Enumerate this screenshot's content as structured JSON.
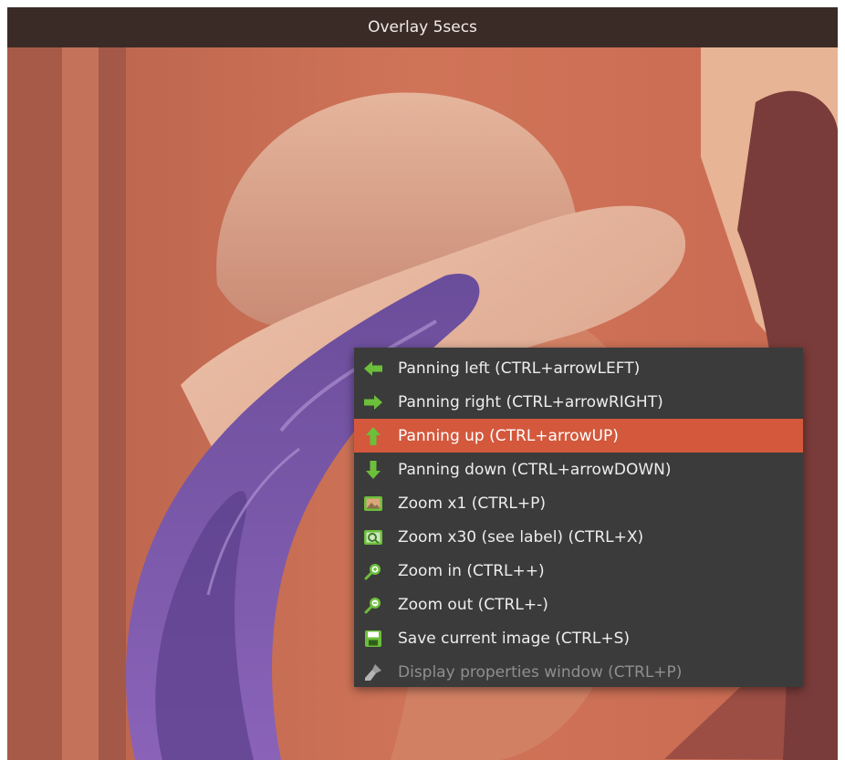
{
  "window": {
    "title": "Overlay 5secs"
  },
  "context_menu": {
    "items": [
      {
        "label": "Panning left (CTRL+arrowLEFT)",
        "icon": "arrow-left-icon",
        "enabled": true
      },
      {
        "label": "Panning right (CTRL+arrowRIGHT)",
        "icon": "arrow-right-icon",
        "enabled": true
      },
      {
        "label": "Panning up (CTRL+arrowUP)",
        "icon": "arrow-up-icon",
        "enabled": true,
        "highlighted": true
      },
      {
        "label": "Panning down (CTRL+arrowDOWN)",
        "icon": "arrow-down-icon",
        "enabled": true
      },
      {
        "label": "Zoom x1 (CTRL+P)",
        "icon": "image-icon",
        "enabled": true
      },
      {
        "label": "Zoom x30 (see label) (CTRL+X)",
        "icon": "zoom-image-icon",
        "enabled": true
      },
      {
        "label": "Zoom in (CTRL++)",
        "icon": "zoom-in-icon",
        "enabled": true
      },
      {
        "label": "Zoom out (CTRL+-)",
        "icon": "zoom-out-icon",
        "enabled": true
      },
      {
        "label": "Save current image (CTRL+S)",
        "icon": "save-icon",
        "enabled": true
      },
      {
        "label": "Display properties window (CTRL+P)",
        "icon": "brush-icon",
        "enabled": false
      }
    ]
  },
  "colors": {
    "titlebar_bg": "#3a2b26",
    "menu_bg": "#3b3b3b",
    "highlight": "#d3583c",
    "icon_green": "#6cbf3a",
    "disabled_text": "#8f8f8f"
  }
}
